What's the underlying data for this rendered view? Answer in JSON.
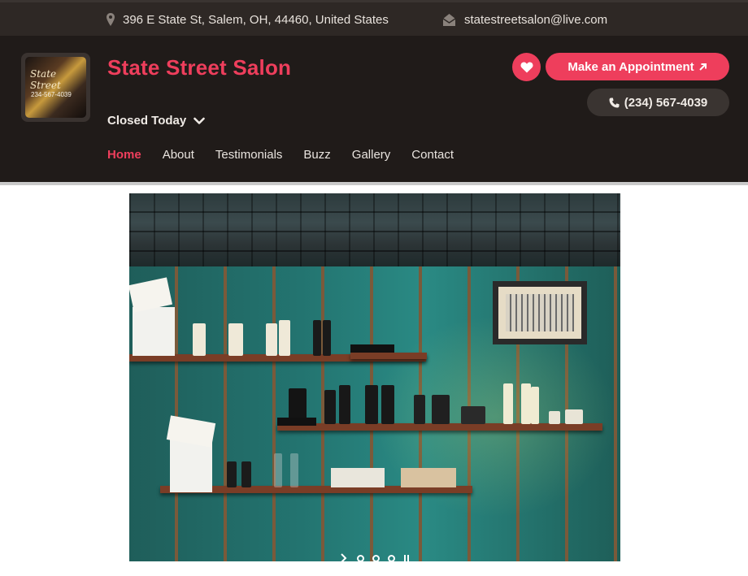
{
  "topbar": {
    "address": "396 E State St, Salem, OH, 44460, United States",
    "email": "statestreetsalon@live.com",
    "address_icon": "map-pin-icon",
    "email_icon": "envelope-open-icon"
  },
  "header": {
    "logo_text_top": "State Street",
    "logo_text_phone": "234-567-4039",
    "title": "State Street Salon",
    "hours_status": "Closed Today",
    "appointment_label": "Make an Appointment",
    "phone_label": "(234) 567-4039"
  },
  "nav": {
    "items": [
      {
        "label": "Home",
        "active": true
      },
      {
        "label": "About",
        "active": false
      },
      {
        "label": "Testimonials",
        "active": false
      },
      {
        "label": "Buzz",
        "active": false
      },
      {
        "label": "Gallery",
        "active": false
      },
      {
        "label": "Contact",
        "active": false
      }
    ]
  },
  "colors": {
    "accent": "#ee3e5c",
    "topbar_bg": "#2e2825",
    "header_bg": "#201b19",
    "pill_bg": "#3a3431"
  },
  "carousel": {
    "slides_dots": 3,
    "controls": [
      "next-arrow-icon",
      "dot",
      "dot",
      "dot",
      "pause-icon"
    ]
  }
}
